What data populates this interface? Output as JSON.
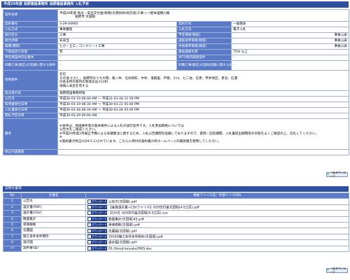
{
  "page_title": "平成29年度 長野建設事務所 長野建設事務所 入札予定",
  "info": {
    "case_name_label": "案件名称",
    "case_name_lines": [
      "平成29年度 防災・安全交付金(修繕)災害防除(地方道)工事 (一)岩本里穂川線",
      "長野市 文田堀"
    ],
    "contract_no_label": "契約番号",
    "contract_no": "3-29-04945",
    "contract_type_label": "契約方式",
    "contract_type": "一般競争",
    "bid_type_label": "入札方式",
    "bid_type": "事後審査",
    "bid_method_label": "入札方法",
    "bid_method": "電子入札",
    "construction_label": "施行区分",
    "construction": "工事",
    "price_label": "予定価格(税抜)",
    "price": "事後公表",
    "eval_label": "総合評価",
    "eval": "非該当",
    "survey_label": "調査基準価格(税抜)",
    "survey": "事後公表",
    "category_label": "業種(種別)",
    "category": "とび・土工・コンクリート工事",
    "min_price_label": "失格基準価格(税抜)",
    "min_price": "事後公表",
    "min_limit_label": "下限設定の有無",
    "min_limit": "有",
    "ops_label": "最低価格比率",
    "ops": "75% 以上",
    "specific_label": "特定建設共同企業体",
    "specific": "-",
    "wto_label": "WTO政府調達案件",
    "wto": "-",
    "compare_label": "同種工事(業区)の実績に関する要件",
    "compare": "-",
    "compare2_label": "同種工事(業区)の契約実績に関する要件",
    "compare2": "-",
    "region_label": "地域要件",
    "region_lines": [
      "北信",
      "その他 ただし、長野市のうち大岡、篠ノ井、信州新町、中条、鬼無里、戸隠、小川、七二会、信更、芋井地区、更北、信濃",
      "の各支所の管内の地域又は小川村",
      "地域に本店を有する"
    ],
    "announcer_label": "発注者の長",
    "announcer": "長野建設事務所長",
    "public_label": "公告日",
    "public_date": "平成30-03-19 08:00 AM ～ 平成31-03-18 11:59 PM",
    "question_label": "質問書受付日時",
    "question_date": "平成30-03-19 08:30 AM ～ 平成30-03-22 05:00 PM",
    "bid_period_label": "入札書受付日時",
    "bid_period": "平成30-03-26 08:30 AM ～ 平成30-03-28 05:00 PM",
    "open_label": "開札予定日時",
    "open_date": "平成30-03-29 09:00 AM",
    "note_label": "備考",
    "note_lines": [
      "※本件は、地域要件等の基本要件による入札の試行案件です。入札参加資格については",
      "公告文をご確認ください。",
      "※平成29年度2月補正予算による早期発注に資するため、入札公告期間を短縮しておりますので、質問・回答期間、入札書提出期間等の日程をよくご確認の上、応札してください。",
      "※",
      "※契約書が改正(H29.5.1)されています。こちらに添付の契約書か県ホームページの最新版を使用してください。"
    ],
    "remarks_label": "修正内容履歴",
    "remarks": ""
  },
  "download_all": "一括ダウンロード",
  "docs_section_title": "説明文書等",
  "docs_headers": {
    "no": "No",
    "name": "文書名",
    "file": "格納ファイル名／外部リンクURL"
  },
  "dl_button_label": "ダウンロード",
  "docs": [
    {
      "no": "1",
      "name": "公告文",
      "file": "公告文(文田堀).pdf"
    },
    {
      "no": "2",
      "name": "設計書(PDF)",
      "file": "【金抜設計書+CSVファイル】H29交付金文田堀(4-S工区).pdf"
    },
    {
      "no": "3",
      "name": "設計書(CSV)",
      "file": "【CSV】H29交付金文田堀(4-S工区).csv"
    },
    {
      "no": "4",
      "name": "数量集計",
      "file": "数量集計(文田堀)45.pdf"
    },
    {
      "no": "5",
      "name": "単価根拠",
      "file": "単価根拠(文田堀).pdf"
    },
    {
      "no": "6",
      "name": "位置図",
      "file": "位置図(文田堀).pdf"
    },
    {
      "no": "7",
      "name": "施工条件条件明示",
      "file": "29100施工条件条件明示(文田堀).pdf"
    },
    {
      "no": "8",
      "name": "設計図",
      "file": "設計図(文田堀).pdf"
    },
    {
      "no": "11",
      "name": "契約書(案)",
      "file": "01-2koujI-keiyaku2905.doc"
    }
  ],
  "colors": {
    "header_bar": "#2f4f9f",
    "label_cell": "#5a7ac8",
    "border": "#9fb0d8",
    "download_button": "#1d3a8a"
  }
}
